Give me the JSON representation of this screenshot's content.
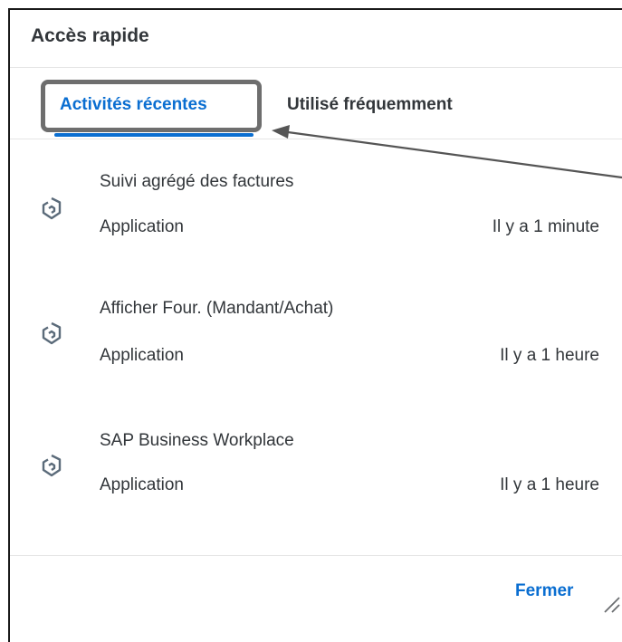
{
  "dialog": {
    "title": "Accès rapide",
    "tabs": [
      {
        "label": "Activités récentes",
        "active": true
      },
      {
        "label": "Utilisé fréquemment",
        "active": false
      }
    ],
    "items": [
      {
        "title": "Suivi agrégé des factures",
        "type": "Application",
        "time": "Il y a 1 minute",
        "icon": "app-icon"
      },
      {
        "title": "Afficher Four. (Mandant/Achat)",
        "type": "Application",
        "time": "Il y a 1 heure",
        "icon": "app-icon"
      },
      {
        "title": "SAP Business Workplace",
        "type": "Application",
        "time": "Il y a 1 heure",
        "icon": "app-icon"
      }
    ],
    "footer": {
      "close_label": "Fermer"
    }
  },
  "colors": {
    "accent": "#0a6ed1",
    "text": "#32363a",
    "highlight": "#6e6e6e"
  }
}
